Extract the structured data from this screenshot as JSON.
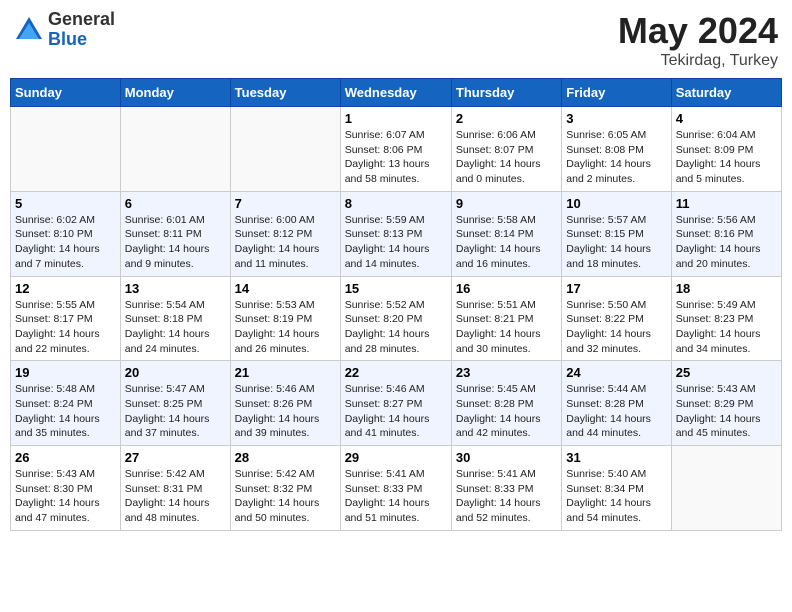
{
  "header": {
    "logo_general": "General",
    "logo_blue": "Blue",
    "title": "May 2024",
    "location": "Tekirdag, Turkey"
  },
  "calendar": {
    "days_of_week": [
      "Sunday",
      "Monday",
      "Tuesday",
      "Wednesday",
      "Thursday",
      "Friday",
      "Saturday"
    ],
    "weeks": [
      [
        {
          "day": "",
          "content": ""
        },
        {
          "day": "",
          "content": ""
        },
        {
          "day": "",
          "content": ""
        },
        {
          "day": "1",
          "content": "Sunrise: 6:07 AM\nSunset: 8:06 PM\nDaylight: 13 hours\nand 58 minutes."
        },
        {
          "day": "2",
          "content": "Sunrise: 6:06 AM\nSunset: 8:07 PM\nDaylight: 14 hours\nand 0 minutes."
        },
        {
          "day": "3",
          "content": "Sunrise: 6:05 AM\nSunset: 8:08 PM\nDaylight: 14 hours\nand 2 minutes."
        },
        {
          "day": "4",
          "content": "Sunrise: 6:04 AM\nSunset: 8:09 PM\nDaylight: 14 hours\nand 5 minutes."
        }
      ],
      [
        {
          "day": "5",
          "content": "Sunrise: 6:02 AM\nSunset: 8:10 PM\nDaylight: 14 hours\nand 7 minutes."
        },
        {
          "day": "6",
          "content": "Sunrise: 6:01 AM\nSunset: 8:11 PM\nDaylight: 14 hours\nand 9 minutes."
        },
        {
          "day": "7",
          "content": "Sunrise: 6:00 AM\nSunset: 8:12 PM\nDaylight: 14 hours\nand 11 minutes."
        },
        {
          "day": "8",
          "content": "Sunrise: 5:59 AM\nSunset: 8:13 PM\nDaylight: 14 hours\nand 14 minutes."
        },
        {
          "day": "9",
          "content": "Sunrise: 5:58 AM\nSunset: 8:14 PM\nDaylight: 14 hours\nand 16 minutes."
        },
        {
          "day": "10",
          "content": "Sunrise: 5:57 AM\nSunset: 8:15 PM\nDaylight: 14 hours\nand 18 minutes."
        },
        {
          "day": "11",
          "content": "Sunrise: 5:56 AM\nSunset: 8:16 PM\nDaylight: 14 hours\nand 20 minutes."
        }
      ],
      [
        {
          "day": "12",
          "content": "Sunrise: 5:55 AM\nSunset: 8:17 PM\nDaylight: 14 hours\nand 22 minutes."
        },
        {
          "day": "13",
          "content": "Sunrise: 5:54 AM\nSunset: 8:18 PM\nDaylight: 14 hours\nand 24 minutes."
        },
        {
          "day": "14",
          "content": "Sunrise: 5:53 AM\nSunset: 8:19 PM\nDaylight: 14 hours\nand 26 minutes."
        },
        {
          "day": "15",
          "content": "Sunrise: 5:52 AM\nSunset: 8:20 PM\nDaylight: 14 hours\nand 28 minutes."
        },
        {
          "day": "16",
          "content": "Sunrise: 5:51 AM\nSunset: 8:21 PM\nDaylight: 14 hours\nand 30 minutes."
        },
        {
          "day": "17",
          "content": "Sunrise: 5:50 AM\nSunset: 8:22 PM\nDaylight: 14 hours\nand 32 minutes."
        },
        {
          "day": "18",
          "content": "Sunrise: 5:49 AM\nSunset: 8:23 PM\nDaylight: 14 hours\nand 34 minutes."
        }
      ],
      [
        {
          "day": "19",
          "content": "Sunrise: 5:48 AM\nSunset: 8:24 PM\nDaylight: 14 hours\nand 35 minutes."
        },
        {
          "day": "20",
          "content": "Sunrise: 5:47 AM\nSunset: 8:25 PM\nDaylight: 14 hours\nand 37 minutes."
        },
        {
          "day": "21",
          "content": "Sunrise: 5:46 AM\nSunset: 8:26 PM\nDaylight: 14 hours\nand 39 minutes."
        },
        {
          "day": "22",
          "content": "Sunrise: 5:46 AM\nSunset: 8:27 PM\nDaylight: 14 hours\nand 41 minutes."
        },
        {
          "day": "23",
          "content": "Sunrise: 5:45 AM\nSunset: 8:28 PM\nDaylight: 14 hours\nand 42 minutes."
        },
        {
          "day": "24",
          "content": "Sunrise: 5:44 AM\nSunset: 8:28 PM\nDaylight: 14 hours\nand 44 minutes."
        },
        {
          "day": "25",
          "content": "Sunrise: 5:43 AM\nSunset: 8:29 PM\nDaylight: 14 hours\nand 45 minutes."
        }
      ],
      [
        {
          "day": "26",
          "content": "Sunrise: 5:43 AM\nSunset: 8:30 PM\nDaylight: 14 hours\nand 47 minutes."
        },
        {
          "day": "27",
          "content": "Sunrise: 5:42 AM\nSunset: 8:31 PM\nDaylight: 14 hours\nand 48 minutes."
        },
        {
          "day": "28",
          "content": "Sunrise: 5:42 AM\nSunset: 8:32 PM\nDaylight: 14 hours\nand 50 minutes."
        },
        {
          "day": "29",
          "content": "Sunrise: 5:41 AM\nSunset: 8:33 PM\nDaylight: 14 hours\nand 51 minutes."
        },
        {
          "day": "30",
          "content": "Sunrise: 5:41 AM\nSunset: 8:33 PM\nDaylight: 14 hours\nand 52 minutes."
        },
        {
          "day": "31",
          "content": "Sunrise: 5:40 AM\nSunset: 8:34 PM\nDaylight: 14 hours\nand 54 minutes."
        },
        {
          "day": "",
          "content": ""
        }
      ]
    ]
  }
}
